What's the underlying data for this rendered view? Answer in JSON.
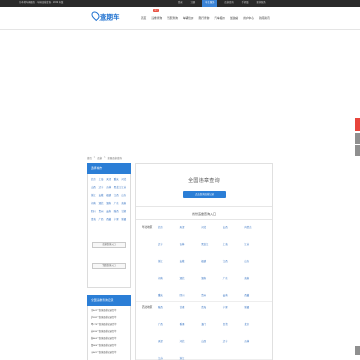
{
  "topbar": {
    "left_text": "为本地车辆服务 · 车辆违章查询 · 2019 年版",
    "right_items": [
      "登录",
      "注册",
      "车主服务",
      "违章查询",
      "手机版",
      "更多服务"
    ],
    "highlight_item": "车主服务"
  },
  "header": {
    "logo_text": "查期车",
    "logo_sub": "chaqiche.com",
    "slogan_line1": "全面查询",
    "slogan_line2": "精准查询",
    "nav": [
      {
        "label": "首页",
        "badge": ""
      },
      {
        "label": "违章查询",
        "badge": "热门"
      },
      {
        "label": "驾照查询",
        "badge": ""
      },
      {
        "label": "车辆估价",
        "badge": ""
      },
      {
        "label": "限行查询",
        "badge": ""
      },
      {
        "label": "汽车报价",
        "badge": ""
      },
      {
        "label": "加油站",
        "badge": ""
      },
      {
        "label": "用户中心",
        "badge": ""
      },
      {
        "label": "新闻资讯",
        "badge": ""
      }
    ]
  },
  "breadcrumb": [
    "首页",
    ">",
    "违章",
    ">",
    "全国违章查询"
  ],
  "left": {
    "city_title": "选择城市",
    "cities": [
      "北京",
      "上海",
      "天津",
      "重庆",
      "河北",
      "山西",
      "辽宁",
      "吉林",
      "黑龙江",
      "江苏",
      "浙江",
      "安徽",
      "福建",
      "江西",
      "山东",
      "河南",
      "湖北",
      "湖南",
      "广东",
      "海南",
      "四川",
      "贵州",
      "云南",
      "陕西",
      "甘肃",
      "青海",
      "广西",
      "西藏",
      "宁夏",
      "新疆"
    ],
    "button1": "违章查询入口",
    "button2": "驾照查询入口",
    "record_title": "全国违章查询记录",
    "records": [
      "京A12**查询违章记录完毕",
      "沪B32**查询违章记录完毕",
      "粤C78**查询违章记录完毕",
      "苏E90**查询违章记录完毕",
      "浙A55**查询违章记录完毕",
      "鲁B66**查询违章记录完毕",
      "川A21**查询违章记录完毕"
    ]
  },
  "main": {
    "title": "全国违章查询",
    "button": "点击查询违章记录",
    "section_title": "省份违章查询入口",
    "regions": [
      {
        "label": "华北地区",
        "provinces": [
          "北京",
          "天津",
          "河北",
          "山西",
          "内蒙古",
          "辽宁",
          "吉林",
          "黑龙江",
          "上海",
          "江苏",
          "浙江",
          "安徽",
          "福建",
          "江西",
          "山东",
          "河南",
          "湖北",
          "湖南",
          "广东",
          "海南",
          "重庆",
          "四川",
          "贵州",
          "云南",
          "西藏"
        ]
      },
      {
        "label": "西北地区",
        "provinces": [
          "陕西",
          "甘肃",
          "青海",
          "宁夏",
          "新疆",
          "广西",
          "香港",
          "澳门",
          "台湾",
          "北京",
          "天津",
          "河北",
          "山西",
          "辽宁",
          "吉林",
          "江苏",
          "浙江"
        ]
      }
    ]
  },
  "colors": {
    "accent": "#2b7ed6",
    "topbar": "#2a2a2a",
    "badge": "#e84b3c",
    "side_red": "#e8453c"
  }
}
